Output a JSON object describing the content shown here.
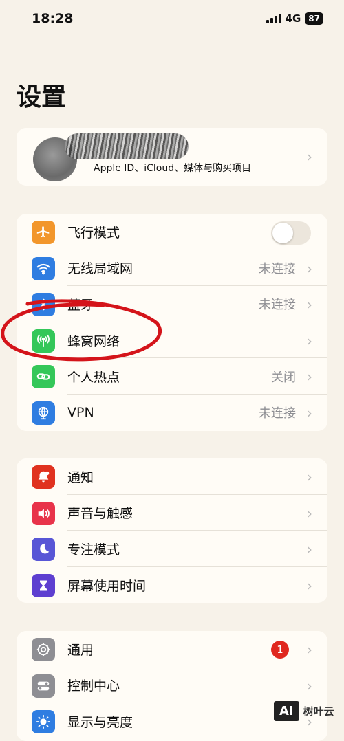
{
  "status": {
    "time": "18:28",
    "network": "4G",
    "battery": "87"
  },
  "title": "设置",
  "profile": {
    "subtitle": "Apple ID、iCloud、媒体与购买项目"
  },
  "group1": [
    {
      "name": "airplane",
      "label": "飞行模式",
      "value": "",
      "color": "#f2962b",
      "icon": "airplane-icon"
    },
    {
      "name": "wifi",
      "label": "无线局域网",
      "value": "未连接",
      "color": "#2f7de1",
      "icon": "wifi-icon"
    },
    {
      "name": "bluetooth",
      "label": "蓝牙",
      "value": "未连接",
      "color": "#2f7de1",
      "icon": "bluetooth-icon"
    },
    {
      "name": "cellular",
      "label": "蜂窝网络",
      "value": "",
      "color": "#34c759",
      "icon": "antenna-icon"
    },
    {
      "name": "hotspot",
      "label": "个人热点",
      "value": "关闭",
      "color": "#34c759",
      "icon": "link-icon"
    },
    {
      "name": "vpn",
      "label": "VPN",
      "value": "未连接",
      "color": "#2f7de1",
      "icon": "globe-icon"
    }
  ],
  "group2": [
    {
      "name": "notifications",
      "label": "通知",
      "color": "#e0321f",
      "icon": "bell-icon"
    },
    {
      "name": "sounds",
      "label": "声音与触感",
      "color": "#e8334a",
      "icon": "speaker-icon"
    },
    {
      "name": "focus",
      "label": "专注模式",
      "color": "#5856d6",
      "icon": "moon-icon"
    },
    {
      "name": "screen-time",
      "label": "屏幕使用时间",
      "color": "#5e3fd0",
      "icon": "hourglass-icon"
    }
  ],
  "group3": [
    {
      "name": "general",
      "label": "通用",
      "badge": "1",
      "color": "#8e8e93",
      "icon": "gear-icon"
    },
    {
      "name": "control-center",
      "label": "控制中心",
      "color": "#8e8e93",
      "icon": "toggles-icon"
    },
    {
      "name": "display",
      "label": "显示与亮度",
      "color": "#2f7de1",
      "icon": "sun-icon"
    }
  ],
  "watermark": {
    "box": "AI",
    "text": "树叶云"
  },
  "colors": {
    "background": "#f7f2e9",
    "card": "#fffcf6",
    "annotation": "#d4141a"
  }
}
